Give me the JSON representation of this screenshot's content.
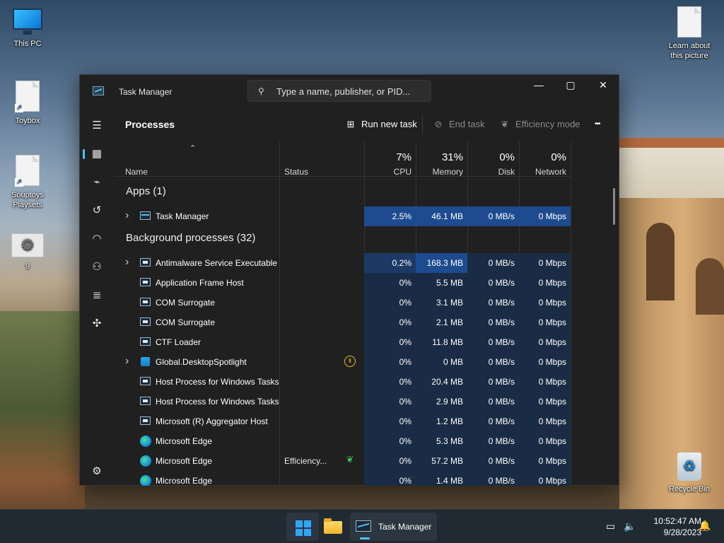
{
  "desktop": {
    "icons": [
      {
        "label": "This PC"
      },
      {
        "label": "Toybox"
      },
      {
        "label": "Souptoys Playsets"
      },
      {
        "label": "9"
      },
      {
        "label": "Learn about this picture"
      },
      {
        "label": "Recycle Bin"
      }
    ]
  },
  "window": {
    "title": "Task Manager",
    "search_placeholder": "Type a name, publisher, or PID...",
    "controls": {
      "minimize": "—",
      "maximize": "▢",
      "close": "✕"
    }
  },
  "sidebar": {
    "items": [
      {
        "icon": "hamburger-icon",
        "glyph": "☰"
      },
      {
        "icon": "processes-icon",
        "glyph": "▦",
        "active": true
      },
      {
        "icon": "performance-icon",
        "glyph": "⌁"
      },
      {
        "icon": "app-history-icon",
        "glyph": "↺"
      },
      {
        "icon": "startup-apps-icon",
        "glyph": "◠"
      },
      {
        "icon": "users-icon",
        "glyph": "⚇"
      },
      {
        "icon": "details-icon",
        "glyph": "≣"
      },
      {
        "icon": "services-icon",
        "glyph": "✣"
      },
      {
        "icon": "settings-icon",
        "glyph": "⚙"
      }
    ]
  },
  "toolbar": {
    "page_title": "Processes",
    "run_new_task": "Run new task",
    "end_task": "End task",
    "efficiency_mode": "Efficiency mode",
    "more": "•••"
  },
  "columns": {
    "name": "Name",
    "status": "Status",
    "cpu": {
      "pct": "7%",
      "label": "CPU"
    },
    "memory": {
      "pct": "31%",
      "label": "Memory"
    },
    "disk": {
      "pct": "0%",
      "label": "Disk"
    },
    "network": {
      "pct": "0%",
      "label": "Network"
    }
  },
  "groups": {
    "apps": "Apps (1)",
    "background": "Background processes (32)"
  },
  "apps": [
    {
      "name": "Task Manager",
      "icon": "tm",
      "expandable": true,
      "status": "",
      "cpu": "2.5%",
      "memory": "46.1 MB",
      "disk": "0 MB/s",
      "network": "0 Mbps"
    }
  ],
  "background": [
    {
      "name": "Antimalware Service Executable",
      "icon": "svc",
      "expandable": true,
      "status": "",
      "cpu": "0.2%",
      "memory": "168.3 MB",
      "disk": "0 MB/s",
      "network": "0 Mbps"
    },
    {
      "name": "Application Frame Host",
      "icon": "svc",
      "expandable": false,
      "status": "",
      "cpu": "0%",
      "memory": "5.5 MB",
      "disk": "0 MB/s",
      "network": "0 Mbps"
    },
    {
      "name": "COM Surrogate",
      "icon": "svc",
      "expandable": false,
      "status": "",
      "cpu": "0%",
      "memory": "3.1 MB",
      "disk": "0 MB/s",
      "network": "0 Mbps"
    },
    {
      "name": "COM Surrogate",
      "icon": "svc",
      "expandable": false,
      "status": "",
      "cpu": "0%",
      "memory": "2.1 MB",
      "disk": "0 MB/s",
      "network": "0 Mbps"
    },
    {
      "name": "CTF Loader",
      "icon": "svc",
      "expandable": false,
      "status": "",
      "cpu": "0%",
      "memory": "11.8 MB",
      "disk": "0 MB/s",
      "network": "0 Mbps"
    },
    {
      "name": "Global.DesktopSpotlight",
      "icon": "spot",
      "expandable": true,
      "status": "",
      "status_icon": "pause-icon",
      "cpu": "0%",
      "memory": "0 MB",
      "disk": "0 MB/s",
      "network": "0 Mbps"
    },
    {
      "name": "Host Process for Windows Tasks",
      "icon": "svc",
      "expandable": false,
      "status": "",
      "cpu": "0%",
      "memory": "20.4 MB",
      "disk": "0 MB/s",
      "network": "0 Mbps"
    },
    {
      "name": "Host Process for Windows Tasks",
      "icon": "svc",
      "expandable": false,
      "status": "",
      "cpu": "0%",
      "memory": "2.9 MB",
      "disk": "0 MB/s",
      "network": "0 Mbps"
    },
    {
      "name": "Microsoft (R) Aggregator Host",
      "icon": "svc",
      "expandable": false,
      "status": "",
      "cpu": "0%",
      "memory": "1.2 MB",
      "disk": "0 MB/s",
      "network": "0 Mbps"
    },
    {
      "name": "Microsoft Edge",
      "icon": "edge",
      "expandable": false,
      "status": "",
      "cpu": "0%",
      "memory": "5.3 MB",
      "disk": "0 MB/s",
      "network": "0 Mbps"
    },
    {
      "name": "Microsoft Edge",
      "icon": "edge",
      "expandable": false,
      "status": "Efficiency...",
      "status_icon": "leaf-icon",
      "cpu": "0%",
      "memory": "57.2 MB",
      "disk": "0 MB/s",
      "network": "0 Mbps"
    },
    {
      "name": "Microsoft Edge",
      "icon": "edge",
      "expandable": false,
      "status": "",
      "cpu": "0%",
      "memory": "1.4 MB",
      "disk": "0 MB/s",
      "network": "0 Mbps"
    }
  ],
  "taskbar": {
    "task_manager_label": "Task Manager",
    "time": "10:52:47 AM",
    "date": "9/28/2023"
  },
  "colors": {
    "accent": "#4cc2ff",
    "heat_light": "#1a2c45",
    "heat_medium": "#1d3a66",
    "heat_strong": "#1e4b8f"
  }
}
